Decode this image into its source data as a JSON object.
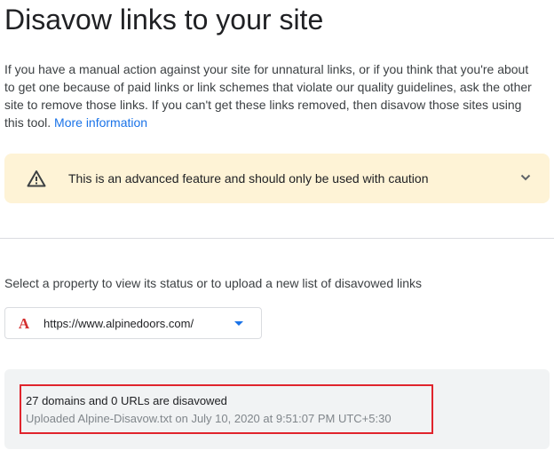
{
  "header": {
    "title": "Disavow links to your site"
  },
  "intro": {
    "text": "If you have a manual action against your site for unnatural links, or if you think that you're about to get one because of paid links or link schemes that violate our quality guidelines, ask the other site to remove those links. If you can't get these links removed, then disavow those sites using this tool. ",
    "link_label": "More information"
  },
  "warning": {
    "icon": "warning-triangle-icon",
    "text": "This is an advanced feature and should only be used with caution",
    "expand_icon": "chevron-down-icon"
  },
  "property_selector": {
    "label": "Select a property to view its status or to upload a new list of disavowed links",
    "selected_favicon": "A",
    "selected_url": "https://www.alpinedoors.com/",
    "arrow_icon": "dropdown-arrow-icon"
  },
  "status": {
    "summary": "27 domains and 0 URLs are disavowed",
    "upload_info": "Uploaded Alpine-Disavow.txt on July 10, 2020 at 9:51:07 PM UTC+5:30",
    "highlight_color": "#e0242c"
  },
  "colors": {
    "accent": "#1a73e8",
    "warning_bg": "#fef3d6",
    "panel_bg": "#f1f3f4"
  }
}
